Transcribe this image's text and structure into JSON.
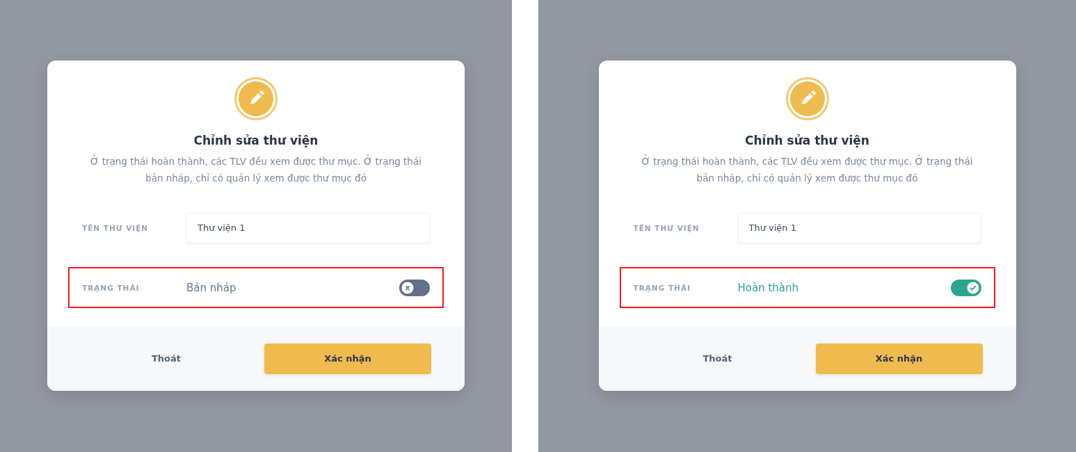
{
  "panels": [
    {
      "dialog": {
        "title": "Chỉnh sửa thư viện",
        "description": "Ở trạng thái hoàn thành, các TLV đều xem được thư mục. Ở trạng thái bản nháp, chỉ có quản lý xem được thư mục đó",
        "name_field": {
          "label": "TÊN THƯ VIỆN",
          "value": "Thư viện 1"
        },
        "status": {
          "label": "TRẠNG THÁI",
          "value": "Bản nháp",
          "on": false,
          "highlighted": true
        },
        "buttons": {
          "cancel": "Thoát",
          "confirm": "Xác nhận"
        }
      }
    },
    {
      "dialog": {
        "title": "Chỉnh sửa thư viện",
        "description": "Ở trạng thái hoàn thành, các TLV đều xem được thư mục. Ở trạng thái bản nháp, chỉ có quản lý xem được thư mục đó",
        "name_field": {
          "label": "TÊN THƯ VIỆN",
          "value": "Thư viện 1"
        },
        "status": {
          "label": "TRẠNG THÁI",
          "value": "Hoàn thành",
          "on": true,
          "highlighted": true
        },
        "buttons": {
          "cancel": "Thoát",
          "confirm": "Xác nhận"
        }
      }
    }
  ]
}
